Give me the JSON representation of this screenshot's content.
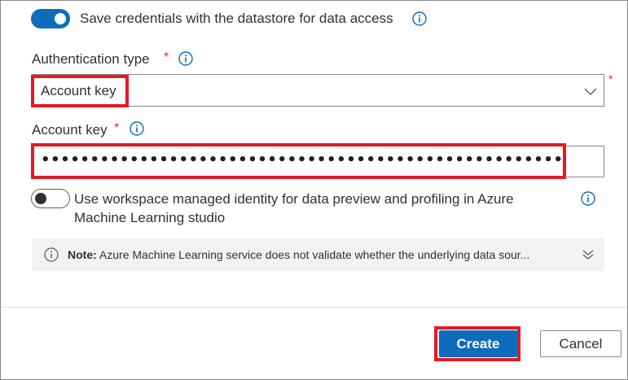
{
  "save_credentials": {
    "label": "Save credentials with the datastore for data access",
    "enabled": true,
    "info_icon": "info-icon"
  },
  "auth_type": {
    "label": "Authentication type",
    "required_mark": "*",
    "info_icon": "info-icon",
    "selected_value": "Account key",
    "dropdown_icon": "chevron-down-icon",
    "side_required_mark": "*"
  },
  "account_key": {
    "label": "Account key",
    "required_mark": "*",
    "info_icon": "info-icon",
    "masked_value": "••••••••••••••••••••••••••••••••••••••••••••••••••••••••••••••••••••••••••••••••••••••"
  },
  "managed_identity": {
    "label_line1": "Use workspace managed identity for data preview and profiling in Azure",
    "label_line2": "Machine Learning studio",
    "enabled": false,
    "info_icon": "info-icon"
  },
  "note": {
    "prefix": "Note:",
    "text": "Azure Machine Learning service does not validate whether the underlying data sour...",
    "icon": "info-icon",
    "expand_icon": "double-chevron-down-icon"
  },
  "actions": {
    "create_label": "Create",
    "cancel_label": "Cancel"
  },
  "colors": {
    "accent": "#0f6cbd",
    "highlight": "#e21b25",
    "required": "#d13438"
  }
}
